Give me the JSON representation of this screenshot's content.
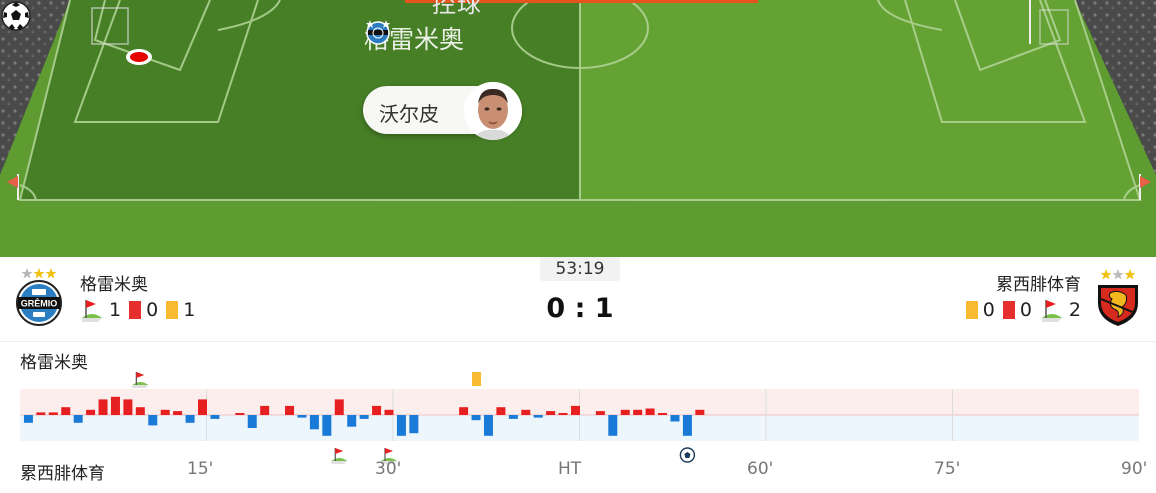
{
  "pitch": {
    "top_cut_text": "控球",
    "attacking_team": "格雷米奥",
    "player_name": "沃尔皮"
  },
  "match": {
    "clock": "53:19",
    "score": "0 : 1",
    "home": {
      "name": "格雷米奥",
      "crest_text": "GRÊMIO",
      "corners": "1",
      "red_cards": "0",
      "yellow_cards": "1"
    },
    "away": {
      "name": "累西腓体育",
      "yellow_cards": "0",
      "red_cards": "0",
      "corners": "2"
    }
  },
  "timeline": {
    "home_label": "格雷米奥",
    "away_label": "累西腓体育",
    "ticks": [
      "15'",
      "30'",
      "HT",
      "60'",
      "75'",
      "90'"
    ],
    "home_color": "#e62020",
    "away_color": "#1a7ad8",
    "bars": [
      {
        "minute": 1,
        "v": -0.3
      },
      {
        "minute": 2,
        "v": 0.1
      },
      {
        "minute": 3,
        "v": 0.1
      },
      {
        "minute": 4,
        "v": 0.3
      },
      {
        "minute": 5,
        "v": -0.3
      },
      {
        "minute": 6,
        "v": 0.2
      },
      {
        "minute": 7,
        "v": 0.6
      },
      {
        "minute": 8,
        "v": 0.7
      },
      {
        "minute": 9,
        "v": 0.6
      },
      {
        "minute": 10,
        "v": 0.3
      },
      {
        "minute": 11,
        "v": -0.4
      },
      {
        "minute": 12,
        "v": 0.2
      },
      {
        "minute": 13,
        "v": 0.15
      },
      {
        "minute": 14,
        "v": -0.3
      },
      {
        "minute": 15,
        "v": 0.6
      },
      {
        "minute": 16,
        "v": -0.15
      },
      {
        "minute": 18,
        "v": 0.05
      },
      {
        "minute": 19,
        "v": -0.5
      },
      {
        "minute": 20,
        "v": 0.35
      },
      {
        "minute": 22,
        "v": 0.35
      },
      {
        "minute": 23,
        "v": -0.1
      },
      {
        "minute": 24,
        "v": -0.55
      },
      {
        "minute": 25,
        "v": -0.8
      },
      {
        "minute": 26,
        "v": 0.6
      },
      {
        "minute": 27,
        "v": -0.45
      },
      {
        "minute": 28,
        "v": -0.15
      },
      {
        "minute": 29,
        "v": 0.35
      },
      {
        "minute": 30,
        "v": 0.2
      },
      {
        "minute": 31,
        "v": -0.8
      },
      {
        "minute": 32,
        "v": -0.7
      },
      {
        "minute": 36,
        "v": 0.3
      },
      {
        "minute": 37,
        "v": -0.2
      },
      {
        "minute": 38,
        "v": -0.8
      },
      {
        "minute": 39,
        "v": 0.3
      },
      {
        "minute": 40,
        "v": -0.15
      },
      {
        "minute": 41,
        "v": 0.2
      },
      {
        "minute": 42,
        "v": -0.1
      },
      {
        "minute": 43,
        "v": 0.15
      },
      {
        "minute": 44,
        "v": 0.05
      },
      {
        "minute": 45,
        "v": 0.35
      },
      {
        "minute": 47,
        "v": 0.15
      },
      {
        "minute": 48,
        "v": -0.8
      },
      {
        "minute": 49,
        "v": 0.2
      },
      {
        "minute": 50,
        "v": 0.2
      },
      {
        "minute": 51,
        "v": 0.25
      },
      {
        "minute": 52,
        "v": 0.05
      },
      {
        "minute": 53,
        "v": -0.25
      },
      {
        "minute": 54,
        "v": -0.8
      },
      {
        "minute": 55,
        "v": 0.2
      }
    ],
    "events": [
      {
        "type": "corner",
        "team": "home",
        "minute": 10
      },
      {
        "type": "yellow-card",
        "team": "home",
        "minute": 37
      },
      {
        "type": "corner",
        "team": "away",
        "minute": 26
      },
      {
        "type": "corner",
        "team": "away",
        "minute": 30
      },
      {
        "type": "goal",
        "team": "away",
        "minute": 54
      }
    ]
  }
}
